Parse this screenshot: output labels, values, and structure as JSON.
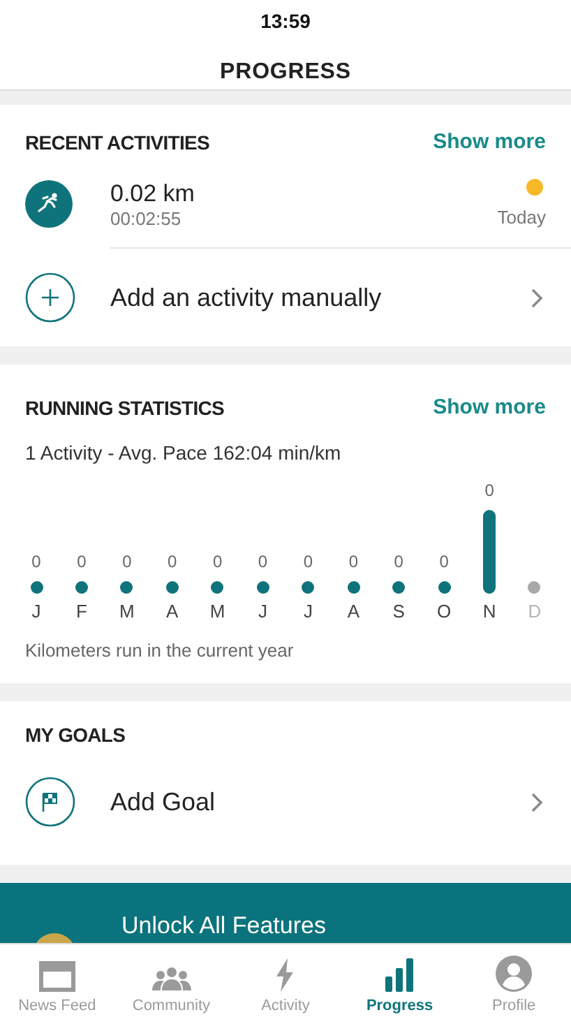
{
  "status_bar": {
    "time": "13:59"
  },
  "header": {
    "title": "PROGRESS"
  },
  "recent_activities": {
    "title": "RECENT ACTIVITIES",
    "link": "Show more",
    "activity": {
      "distance": "0.02 km",
      "duration": "00:02:55",
      "date": "Today",
      "color": "#f7b928"
    },
    "add_row": {
      "label": "Add an activity manually"
    }
  },
  "running_statistics": {
    "title": "RUNNING STATISTICS",
    "link": "Show more",
    "summary": "1 Activity - Avg. Pace 162:04 min/km",
    "months": [
      {
        "label": "J",
        "value": "0",
        "kind": "dot"
      },
      {
        "label": "F",
        "value": "0",
        "kind": "dot"
      },
      {
        "label": "M",
        "value": "0",
        "kind": "dot"
      },
      {
        "label": "A",
        "value": "0",
        "kind": "dot"
      },
      {
        "label": "M",
        "value": "0",
        "kind": "dot"
      },
      {
        "label": "J",
        "value": "0",
        "kind": "dot"
      },
      {
        "label": "J",
        "value": "0",
        "kind": "dot"
      },
      {
        "label": "A",
        "value": "0",
        "kind": "dot"
      },
      {
        "label": "S",
        "value": "0",
        "kind": "dot"
      },
      {
        "label": "O",
        "value": "0",
        "kind": "dot"
      },
      {
        "label": "N",
        "value": "0",
        "kind": "bar"
      },
      {
        "label": "D",
        "kind": "future"
      }
    ],
    "caption": "Kilometers run in the current year"
  },
  "my_goals": {
    "title": "MY GOALS",
    "add_row": {
      "label": "Add Goal"
    }
  },
  "banner": {
    "title": "Unlock All Features"
  },
  "tab_bar": [
    {
      "label": "News Feed",
      "kind": "news",
      "selected": false
    },
    {
      "label": "Community",
      "kind": "community",
      "selected": false
    },
    {
      "label": "Activity",
      "kind": "activity",
      "selected": false
    },
    {
      "label": "Progress",
      "kind": "progress",
      "selected": true
    },
    {
      "label": "Profile",
      "kind": "profile",
      "selected": false
    }
  ]
}
